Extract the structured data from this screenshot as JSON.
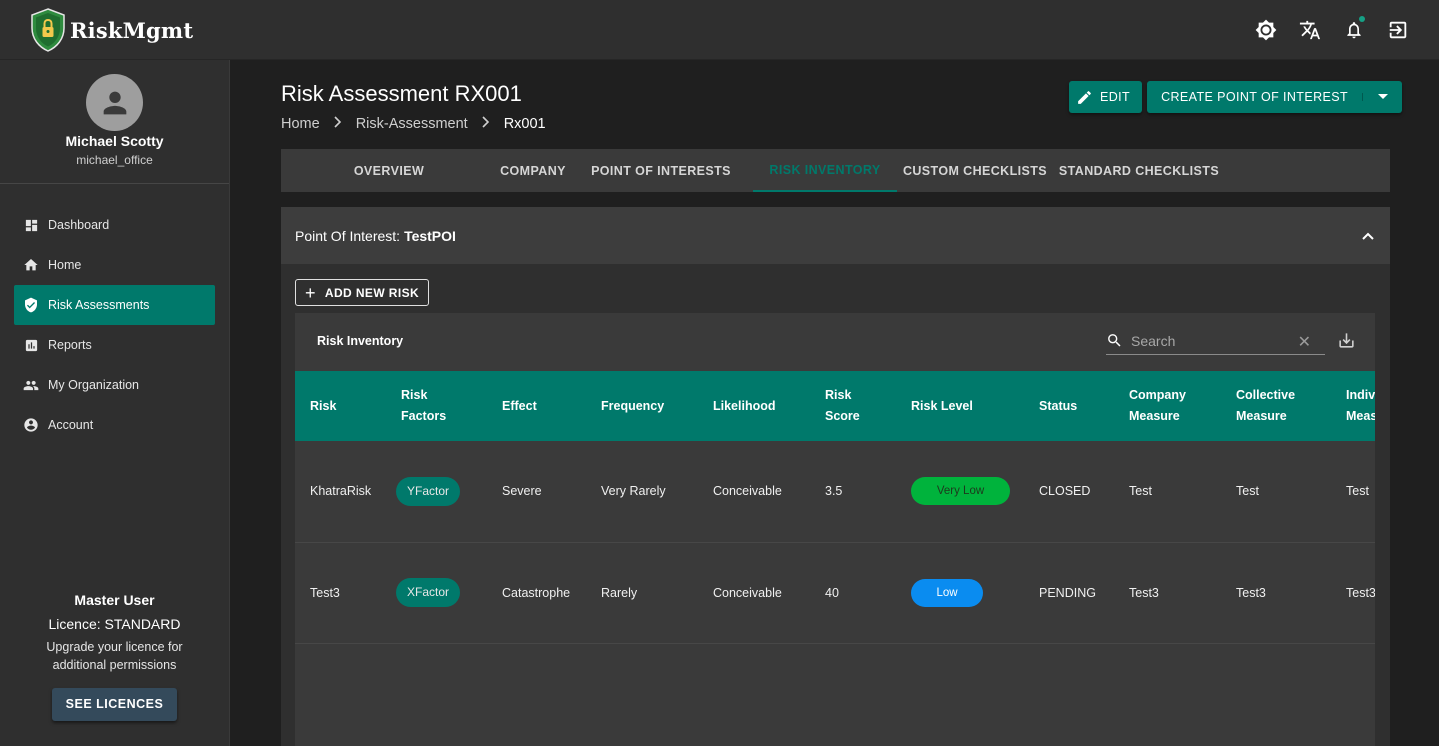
{
  "app": {
    "name": "RiskMgmt"
  },
  "user": {
    "name": "Michael Scotty",
    "username": "michael_office"
  },
  "nav": [
    {
      "label": "Dashboard",
      "icon": "dashboard-icon"
    },
    {
      "label": "Home",
      "icon": "home-icon"
    },
    {
      "label": "Risk Assessments",
      "icon": "shield-check-icon",
      "active": true
    },
    {
      "label": "Reports",
      "icon": "bar-chart-icon"
    },
    {
      "label": "My Organization",
      "icon": "people-icon"
    },
    {
      "label": "Account",
      "icon": "account-circle-icon"
    }
  ],
  "licence": {
    "role": "Master User",
    "level": "Licence: STANDARD",
    "message_line1": "Upgrade your licence for",
    "message_line2": "additional permissions",
    "button": "SEE LICENCES"
  },
  "page": {
    "title": "Risk Assessment RX001",
    "breadcrumb": [
      "Home",
      "Risk-Assessment",
      "Rx001"
    ],
    "edit_button": "EDIT",
    "create_button": "CREATE POINT OF INTEREST"
  },
  "tabs": [
    "OVERVIEW",
    "COMPANY",
    "POINT OF INTERESTS",
    "RISK INVENTORY",
    "CUSTOM CHECKLISTS",
    "STANDARD CHECKLISTS"
  ],
  "active_tab": "RISK INVENTORY",
  "poi": {
    "label": "Point Of Interest:",
    "value": "TestPOI"
  },
  "add_risk_button": "ADD NEW RISK",
  "inventory": {
    "title": "Risk Inventory",
    "search_placeholder": "Search",
    "headers": [
      [
        "Risk"
      ],
      [
        "Risk",
        "Factors"
      ],
      [
        "Effect"
      ],
      [
        "Frequency"
      ],
      [
        "Likelihood"
      ],
      [
        "Risk",
        "Score"
      ],
      [
        "Risk Level"
      ],
      [
        "Status"
      ],
      [
        "Company",
        "Measure"
      ],
      [
        "Collective",
        "Measure"
      ],
      [
        "Individual",
        "Measure"
      ]
    ],
    "rows": [
      {
        "risk": "KhatraRisk",
        "factor": "YFactor",
        "effect": "Severe",
        "frequency": "Very Rarely",
        "likelihood": "Conceivable",
        "score": "3.5",
        "level": "Very Low",
        "level_color": "#00b33c",
        "level_text_color": "#1d3a1d",
        "status": "CLOSED",
        "company": "Test",
        "collective": "Test",
        "individual": "Test"
      },
      {
        "risk": "Test3",
        "factor": "XFactor",
        "effect": "Catastrophe",
        "frequency": "Rarely",
        "likelihood": "Conceivable",
        "score": "40",
        "level": "Low",
        "level_color": "#0a8cf0",
        "level_text_color": "#ffffff",
        "status": "PENDING",
        "company": "Test3",
        "collective": "Test3",
        "individual": "Test3"
      }
    ]
  },
  "colors": {
    "accent": "#00796b",
    "topbar": "#2f2f2f",
    "background": "#1f1f1f"
  }
}
